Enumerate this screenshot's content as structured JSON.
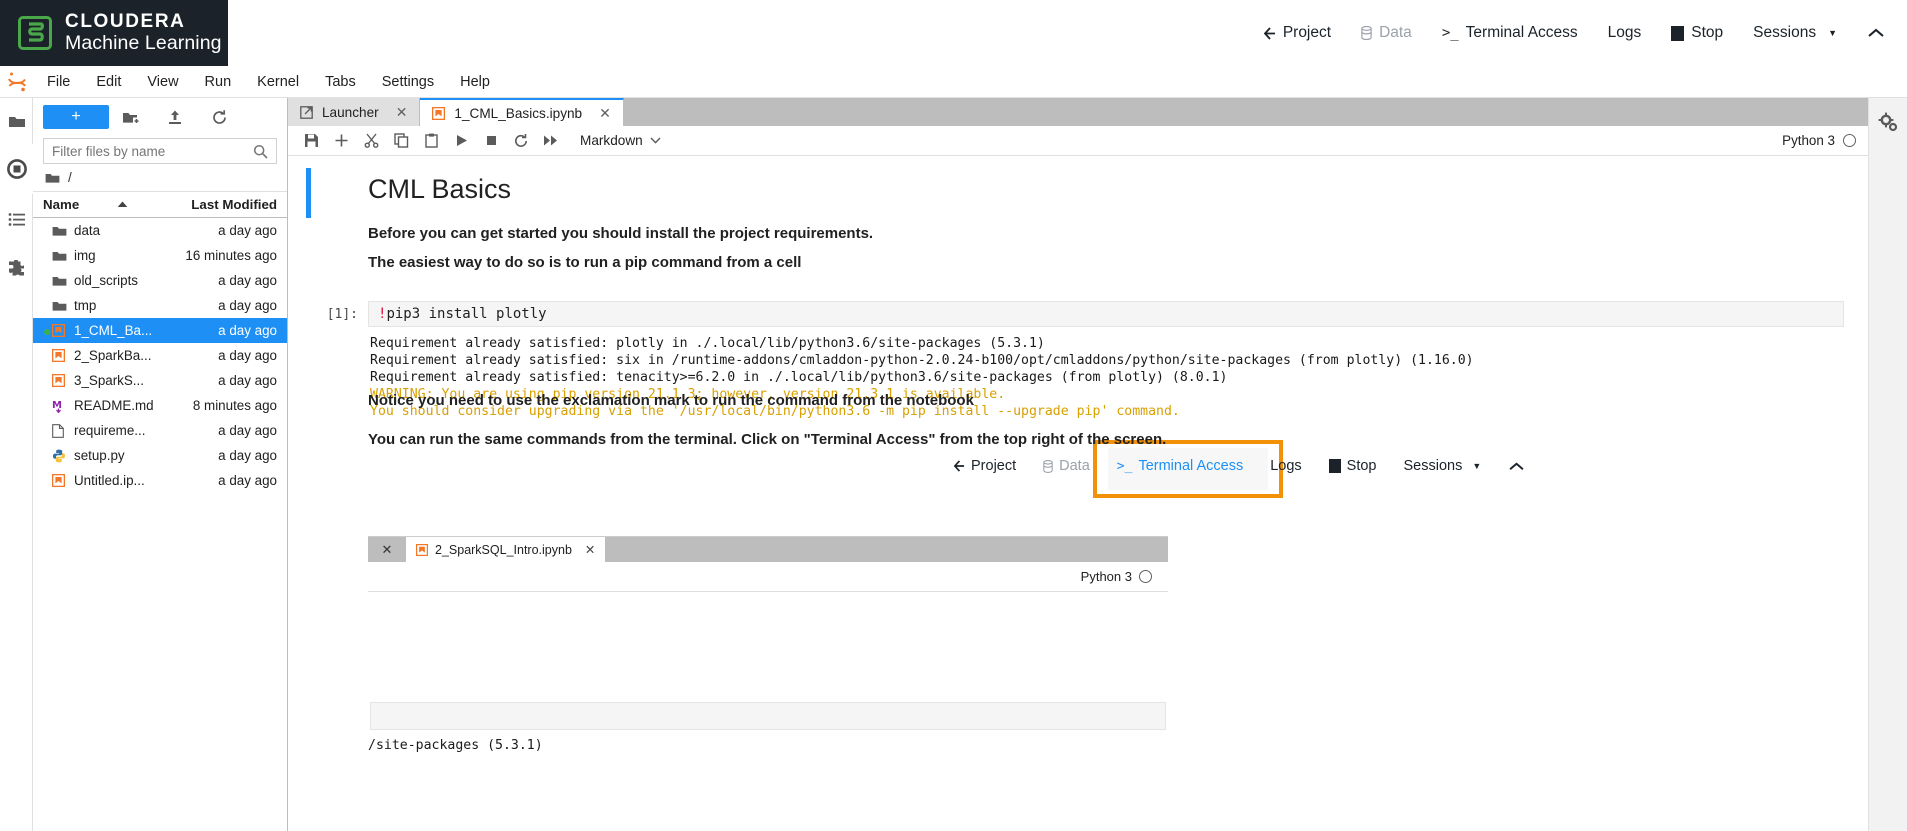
{
  "cml_header": {
    "brand_line1": "CLOUDERA",
    "brand_line2": "Machine Learning",
    "logo_icon": "cloudera-logo-icon",
    "nav": [
      {
        "label": "Project",
        "icon": "back-arrow-icon",
        "muted": false
      },
      {
        "label": "Data",
        "icon": "database-icon",
        "muted": true
      },
      {
        "label": "Terminal Access",
        "icon": "terminal-prompt-icon",
        "muted": false
      },
      {
        "label": "Logs",
        "icon": "",
        "muted": false
      },
      {
        "label": "Stop",
        "icon": "stop-square-icon",
        "muted": false
      },
      {
        "label": "Sessions",
        "icon": "chevron-down-icon",
        "muted": false
      }
    ],
    "collapse_icon": "chevron-up-icon"
  },
  "jupyter_menubar": {
    "logo_icon": "jupyter-logo-icon",
    "menus": [
      "File",
      "Edit",
      "View",
      "Run",
      "Kernel",
      "Tabs",
      "Settings",
      "Help"
    ]
  },
  "activity_bar": {
    "items": [
      {
        "name": "file-browser",
        "icon": "folder-icon"
      },
      {
        "name": "running-sessions",
        "icon": "running-circle-icon"
      },
      {
        "name": "commands",
        "icon": "list-icon"
      },
      {
        "name": "extension-manager",
        "icon": "puzzle-icon"
      }
    ]
  },
  "file_browser": {
    "new_launcher_label": "+",
    "toolbar_icons": [
      "new-folder-icon",
      "upload-icon",
      "refresh-icon"
    ],
    "filter_placeholder": "Filter files by name",
    "filter_value": "",
    "search_icon": "search-icon",
    "breadcrumb": "/",
    "breadcrumb_icon": "folder-icon",
    "columns": {
      "name": "Name",
      "last_modified": "Last Modified",
      "sort_icon": "sort-asc-icon"
    },
    "files": [
      {
        "name": "data",
        "modified": "a day ago",
        "icon": "folder-icon",
        "selected": false,
        "running": false
      },
      {
        "name": "img",
        "modified": "16 minutes ago",
        "icon": "folder-icon",
        "selected": false,
        "running": false
      },
      {
        "name": "old_scripts",
        "modified": "a day ago",
        "icon": "folder-icon",
        "selected": false,
        "running": false
      },
      {
        "name": "tmp",
        "modified": "a day ago",
        "icon": "folder-icon",
        "selected": false,
        "running": false
      },
      {
        "name": "1_CML_Ba...",
        "modified": "a day ago",
        "icon": "notebook-icon",
        "selected": true,
        "running": true
      },
      {
        "name": "2_SparkBa...",
        "modified": "a day ago",
        "icon": "notebook-icon",
        "selected": false,
        "running": false
      },
      {
        "name": "3_SparkS...",
        "modified": "a day ago",
        "icon": "notebook-icon",
        "selected": false,
        "running": false
      },
      {
        "name": "README.md",
        "modified": "8 minutes ago",
        "icon": "markdown-icon",
        "selected": false,
        "running": false
      },
      {
        "name": "requireme...",
        "modified": "a day ago",
        "icon": "text-file-icon",
        "selected": false,
        "running": false
      },
      {
        "name": "setup.py",
        "modified": "a day ago",
        "icon": "python-icon",
        "selected": false,
        "running": false
      },
      {
        "name": "Untitled.ip...",
        "modified": "a day ago",
        "icon": "notebook-icon",
        "selected": false,
        "running": false
      }
    ]
  },
  "dock": {
    "tabs": [
      {
        "label": "Launcher",
        "icon": "launcher-icon",
        "current": false,
        "close_icon": "close-icon"
      },
      {
        "label": "1_CML_Basics.ipynb",
        "icon": "notebook-icon",
        "current": true,
        "close_icon": "close-icon"
      }
    ]
  },
  "notebook_toolbar": {
    "icons": [
      "save-icon",
      "insert-cell-icon",
      "cut-icon",
      "copy-icon",
      "paste-icon",
      "run-icon",
      "interrupt-icon",
      "restart-icon",
      "restart-run-all-icon"
    ],
    "cell_type": "Markdown",
    "cell_type_caret": "chevron-down-icon",
    "kernel_name": "Python 3",
    "kernel_status_icon": "kernel-idle-icon"
  },
  "notebook": {
    "title": "CML Basics",
    "paragraphs": [
      "Before you can get started you should install the project requirements.",
      "The easiest way to do so is to run a pip command from a cell"
    ],
    "code_cell": {
      "prompt": "[1]:",
      "bang": "!",
      "source": "pip3 install plotly",
      "output_lines": [
        {
          "text": "Requirement already satisfied: plotly in ./.local/lib/python3.6/site-packages (5.3.1)",
          "warn": false
        },
        {
          "text": "Requirement already satisfied: six in /runtime-addons/cmladdon-python-2.0.24-b100/opt/cmladdons/python/site-packages (from plotly) (1.16.0)",
          "warn": false
        },
        {
          "text": "Requirement already satisfied: tenacity>=6.2.0 in ./.local/lib/python3.6/site-packages (from plotly) (8.0.1)",
          "warn": false
        },
        {
          "text": "WARNING: You are using pip version 21.1.3; however, version 21.3.1 is available.",
          "warn": true
        },
        {
          "text": "You should consider upgrading via the '/usr/local/bin/python3.6 -m pip install --upgrade pip' command.",
          "warn": true
        }
      ]
    },
    "paragraphs2": [
      "Notice you need to use the exclamation mark to run the command from the notebook",
      "You can run the same commands from the terminal. Click on \"Terminal Access\" from the top right of the screen."
    ],
    "embedded_image_1": {
      "alt": "cml-top-nav-screenshot",
      "highlight_color": "#f2920a",
      "highlighted_item": "Terminal Access",
      "nav": [
        {
          "label": "Project",
          "icon": "back-arrow-icon",
          "muted": false,
          "highlighted": false
        },
        {
          "label": "Data",
          "icon": "database-icon",
          "muted": true,
          "highlighted": false
        },
        {
          "label": "Terminal Access",
          "icon": "terminal-prompt-icon",
          "muted": false,
          "highlighted": true
        },
        {
          "label": "Logs",
          "icon": "",
          "muted": false,
          "highlighted": false
        },
        {
          "label": "Stop",
          "icon": "stop-square-icon",
          "muted": false,
          "highlighted": false
        },
        {
          "label": "Sessions",
          "icon": "chevron-down-icon",
          "muted": false,
          "highlighted": false
        }
      ],
      "collapse_icon": "chevron-up-icon"
    },
    "embedded_image_2": {
      "alt": "jupyterlab-notebook-screenshot",
      "close_icon": "close-icon",
      "tab_label": "2_SparkSQL_Intro.ipynb",
      "tab_icon": "notebook-icon",
      "tab_close_icon": "close-icon",
      "kernel_name": "Python 3",
      "kernel_status_icon": "kernel-idle-icon",
      "output_text": "/site-packages (5.3.1)"
    }
  },
  "right_bar": {
    "items": [
      {
        "name": "property-inspector",
        "icon": "gears-icon"
      }
    ]
  },
  "colors": {
    "cml_dark": "#1b2229",
    "cloudera_green": "#4aa84a",
    "jupyter_blue": "#1e90f5",
    "highlight_orange": "#f2920a",
    "warning_yellow": "#d8a000",
    "notebook_orange": "#f37726"
  }
}
